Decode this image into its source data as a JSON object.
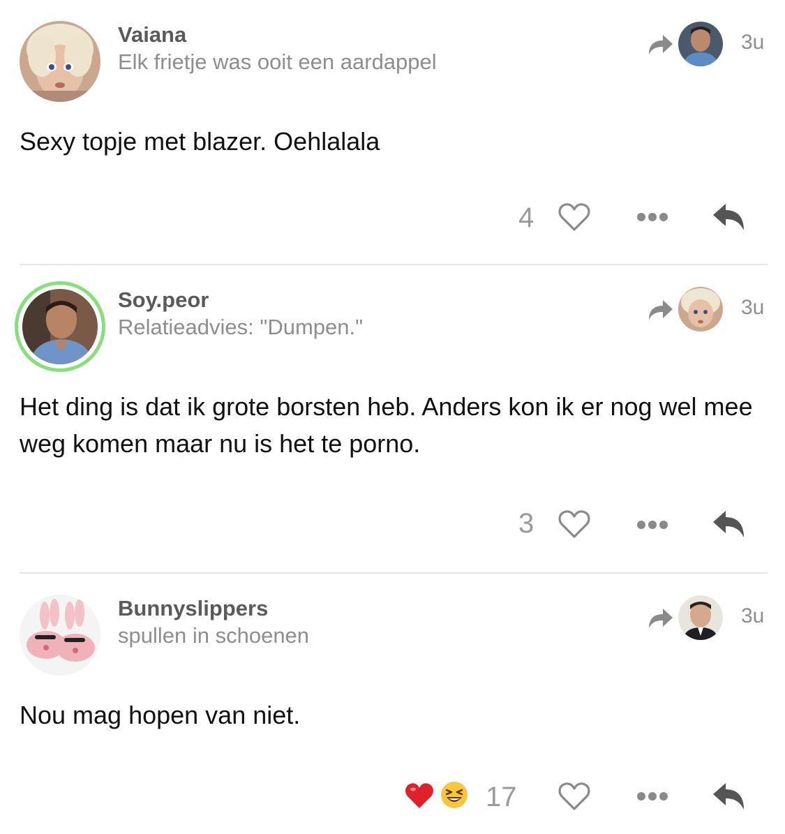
{
  "posts": [
    {
      "username": "Vaiana",
      "bio": "Elk frietje was ooit een aardappel",
      "timestamp": "3u",
      "text": "Sexy topje met blazer. Oehlalala",
      "likes": "4"
    },
    {
      "username": "Soy.peor",
      "bio": "Relatieadvies: \"Dumpen.\"",
      "timestamp": "3u",
      "text": "Het ding is dat ik grote borsten heb. Anders kon ik er nog wel mee weg komen maar nu is het te porno.",
      "likes": "3"
    },
    {
      "username": "Bunnyslippers",
      "bio": "spullen in schoenen",
      "timestamp": "3u",
      "text": "Nou mag hopen van niet.",
      "likes": "17",
      "reactions": [
        "heart-emoji",
        "laughing-emoji"
      ]
    }
  ],
  "icons": {
    "share": "share-arrow-icon",
    "like": "heart-outline-icon",
    "more": "more-dots-icon",
    "reply": "reply-arrow-icon"
  },
  "colors": {
    "username": "#5a5a5a",
    "secondary_text": "#8e8e8e",
    "body_text": "#111111",
    "icon_gray": "#8a8a8a",
    "online_ring": "#86e07a",
    "divider": "#e6e6e6"
  }
}
